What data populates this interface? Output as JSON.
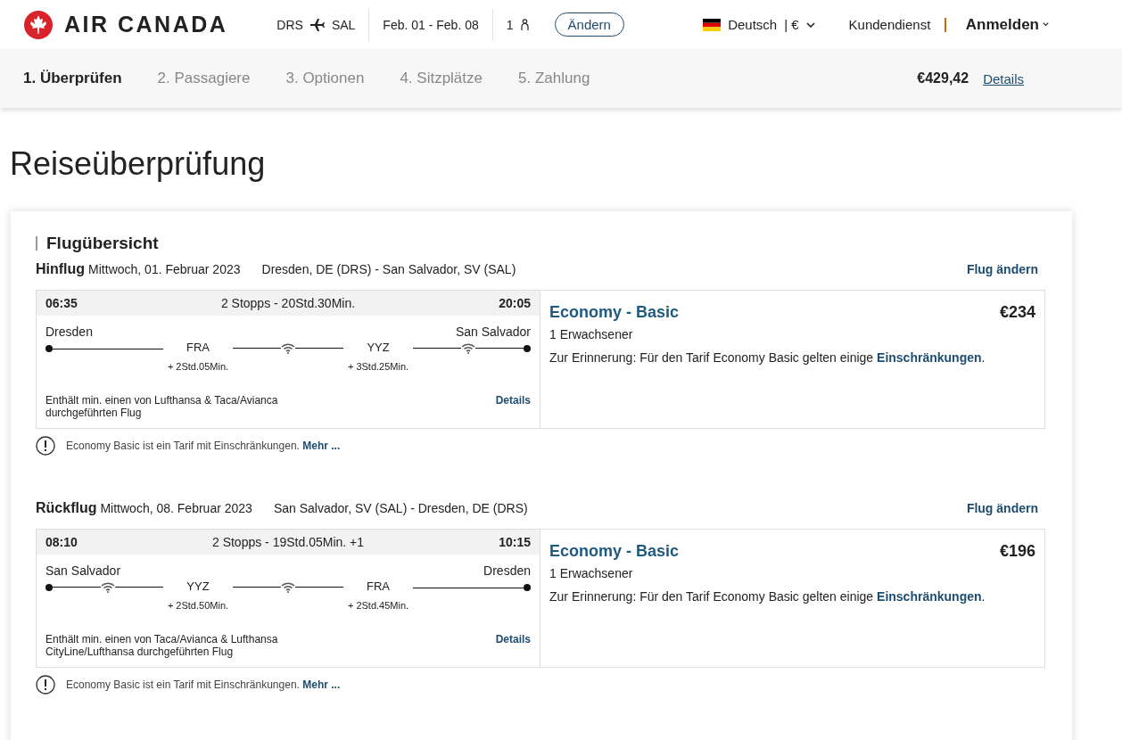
{
  "header": {
    "brand": "AIR CANADA",
    "trip": {
      "origin": "DRS",
      "destination": "SAL",
      "dates": "Feb. 01 - Feb. 08",
      "passengers": "1"
    },
    "change_button": "Ändern",
    "language": "Deutsch",
    "currency": "| €",
    "support": "Kundendienst",
    "login": "Anmelden"
  },
  "steps": [
    {
      "label": "1. Überprüfen",
      "selected": true
    },
    {
      "label": "2. Passagiere",
      "selected": false
    },
    {
      "label": "3. Optionen",
      "selected": false
    },
    {
      "label": "4. Sitzplätze",
      "selected": false
    },
    {
      "label": "5. Zahlung",
      "selected": false
    }
  ],
  "total": {
    "price": "€429,42",
    "details": "Details"
  },
  "title": "Reiseüberprüfung",
  "section_title": "Flugübersicht",
  "flights": [
    {
      "direction": "Hinflug",
      "date": "Mittwoch, 01. Februar 2023",
      "route": "Dresden, DE (DRS) - San Salvador, SV (SAL)",
      "change_link": "Flug ändern",
      "depart": "06:35",
      "summary": "2 Stopps - 20Std.30Min.",
      "arrive": "20:05",
      "origin": "Dresden",
      "destination": "San Salvador",
      "segments": [
        {
          "wifi": false
        },
        {
          "wifi": true
        },
        {
          "wifi": true
        }
      ],
      "stops": [
        {
          "code": "FRA",
          "layover": "+ 2Std.05Min."
        },
        {
          "code": "YYZ",
          "layover": "+ 3Std.25Min."
        }
      ],
      "operator": "Enthält min. einen von Lufthansa & Taca/Avianca durchgeführten Flug",
      "details": "Details",
      "fare": "Economy - Basic",
      "price": "€234",
      "travellers": "1 Erwachsener",
      "reminder": "Zur Erinnerung: Für den Tarif Economy Basic gelten einige ",
      "reminder_link": "Einschränkungen",
      "reminder_end": ".",
      "notice": "Economy Basic ist ein Tarif mit Einschränkungen. ",
      "notice_link": "Mehr ..."
    },
    {
      "direction": "Rückflug",
      "date": "Mittwoch, 08. Februar 2023",
      "route": "San Salvador, SV (SAL) - Dresden, DE (DRS)",
      "change_link": "Flug ändern",
      "depart": "08:10",
      "summary": "2 Stopps - 19Std.05Min. +1",
      "arrive": "10:15",
      "origin": "San Salvador",
      "destination": "Dresden",
      "segments": [
        {
          "wifi": true
        },
        {
          "wifi": true
        },
        {
          "wifi": false
        }
      ],
      "stops": [
        {
          "code": "YYZ",
          "layover": "+ 2Std.50Min."
        },
        {
          "code": "FRA",
          "layover": "+ 2Std.45Min."
        }
      ],
      "operator": "Enthält min. einen von Taca/Avianca & Lufthansa CityLine/Lufthansa durchgeführten Flug",
      "details": "Details",
      "fare": "Economy - Basic",
      "price": "€196",
      "travellers": "1 Erwachsener",
      "reminder": "Zur Erinnerung: Für den Tarif Economy Basic gelten einige ",
      "reminder_link": "Einschränkungen",
      "reminder_end": ".",
      "notice": "Economy Basic ist ein Tarif mit Einschränkungen. ",
      "notice_link": "Mehr ..."
    }
  ]
}
